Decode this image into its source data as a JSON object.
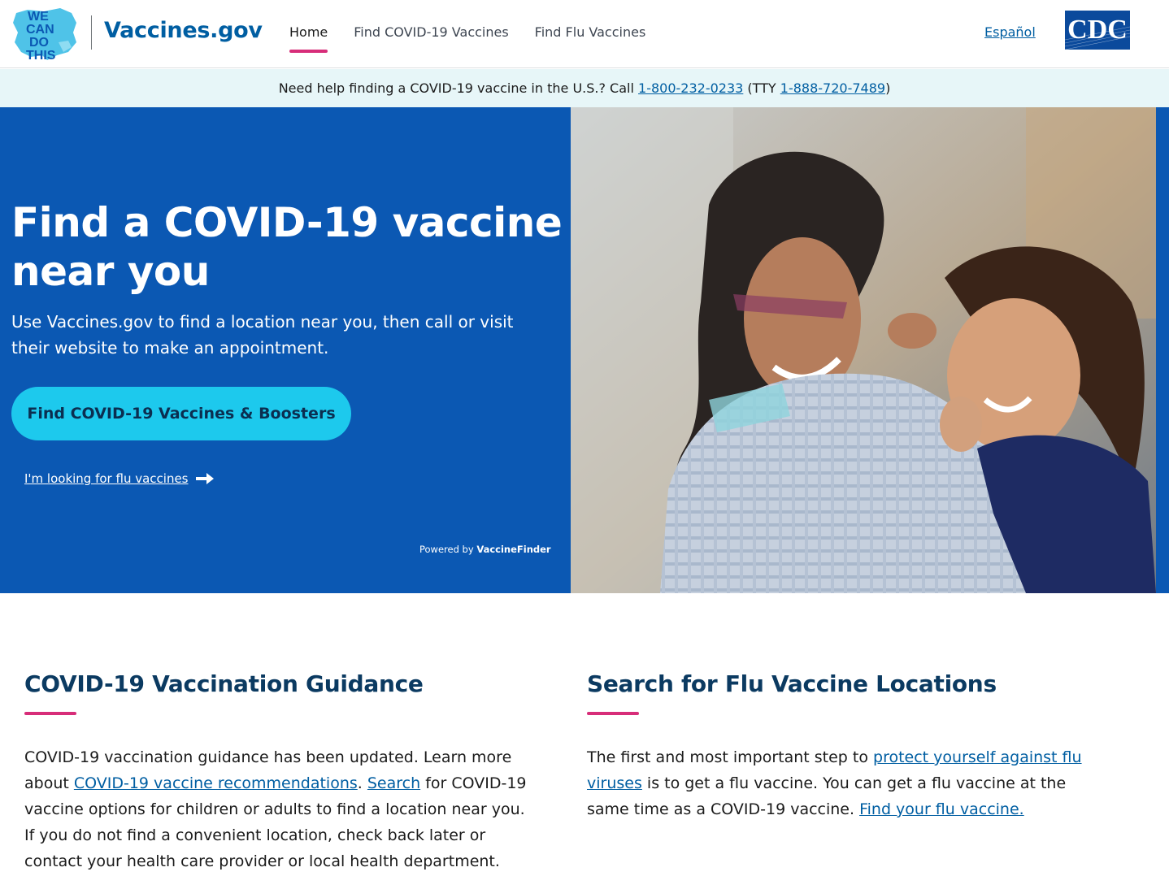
{
  "header": {
    "logo_text": [
      "WE",
      "CAN",
      "DO",
      "THIS"
    ],
    "site_title": "Vaccines.gov",
    "nav": [
      {
        "label": "Home"
      },
      {
        "label": "Find COVID-19 Vaccines"
      },
      {
        "label": "Find Flu Vaccines"
      }
    ],
    "language_link": "Español",
    "cdc_logo_text": "CDC"
  },
  "help_banner": {
    "text_before": "Need help finding a COVID-19 vaccine in the U.S.? Call ",
    "phone": "1-800-232-0233",
    "text_middle": " (TTY ",
    "tty": "1-888-720-7489",
    "text_after": ")"
  },
  "hero": {
    "title": "Find a COVID-19 vaccine near you",
    "subtitle": "Use Vaccines.gov to find a location near you, then call or visit their website to make an appointment.",
    "button_label": "Find COVID-19 Vaccines & Boosters",
    "flu_link": "I'm looking for flu vaccines",
    "powered_by_prefix": "Powered by ",
    "powered_by_brand": "VaccineFinder"
  },
  "guidance": {
    "title": "COVID-19 Vaccination Guidance",
    "text_1": "COVID-19 vaccination guidance has been updated.  Learn more about ",
    "link_1": "COVID-19 vaccine recommendations",
    "text_2": ". ",
    "link_2": "Search",
    "text_3": " for COVID-19 vaccine options for children or adults to find a location near you. If you do not find a convenient location, check back later or contact your health care provider or local health department."
  },
  "flu": {
    "title": "Search for Flu Vaccine Locations",
    "text_1": "The first and most important step to ",
    "link_1": "protect yourself against flu viruses",
    "text_2": " is to get a flu vaccine. You can get a flu vaccine at the same time as a COVID-19 vaccine. ",
    "link_2": "Find your flu vaccine."
  },
  "colors": {
    "hero_bg": "#0b58b3",
    "accent_pink": "#d72d79",
    "button_cyan": "#1dc9ed",
    "link_blue": "#005ea2",
    "heading_navy": "#0b3a61",
    "banner_bg": "#e7f6f8"
  }
}
